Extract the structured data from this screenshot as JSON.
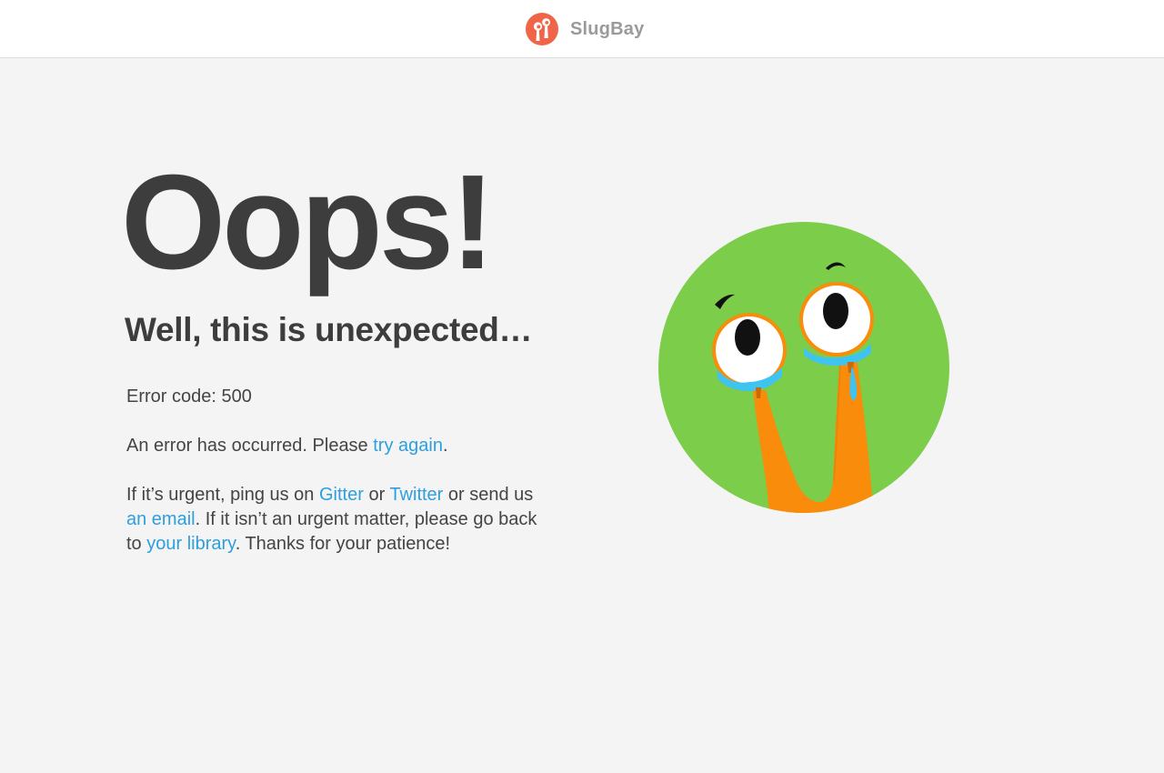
{
  "header": {
    "brand_name": "SlugBay",
    "logo_icon": "slugbay-logo-icon",
    "logo_color": "#f06548"
  },
  "main": {
    "headline": "Oops!",
    "subheadline": "Well, this is unexpected…",
    "error_code_text": "Error code: 500",
    "error_message": {
      "before": "An error has occurred. Please ",
      "link": "try again",
      "after": "."
    },
    "urgent_message": {
      "part1": "If it’s urgent, ping us on ",
      "gitter_link": "Gitter",
      "part2": " or ",
      "twitter_link": "Twitter",
      "part3": " or send us ",
      "email_link": "an email",
      "part4": ". If it isn’t an urgent matter, please go back to ",
      "library_link": "your library",
      "part5": ". Thanks for your patience!"
    }
  },
  "illustration": {
    "icon": "crying-slug-icon",
    "circle_color": "#7ccd49",
    "slug_color": "#f98c0a",
    "tear_color": "#3fc3f0"
  },
  "colors": {
    "background": "#f4f4f4",
    "text": "#444444",
    "link": "#2e9fde"
  }
}
